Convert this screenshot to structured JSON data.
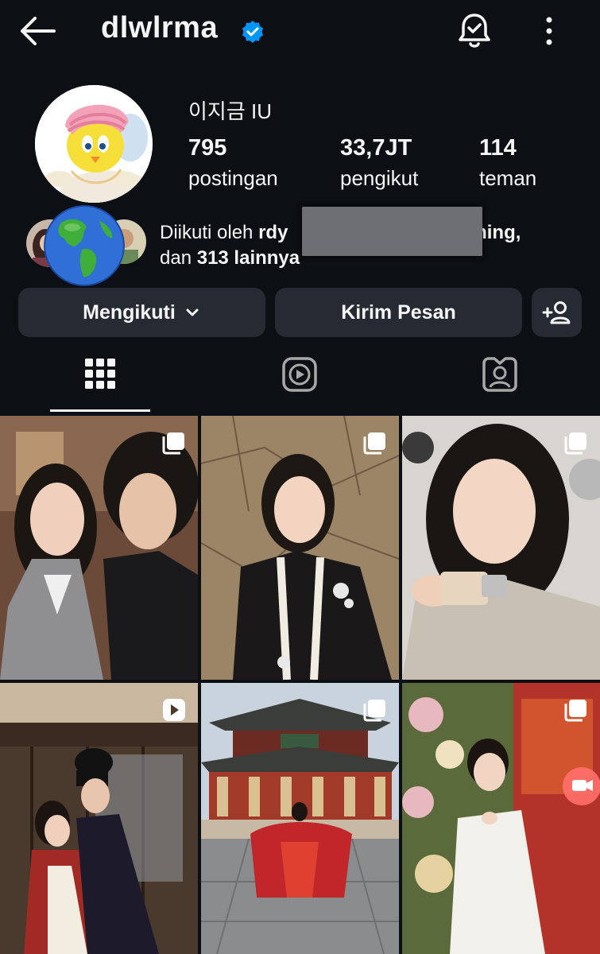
{
  "header": {
    "username": "dlwlrma"
  },
  "profile": {
    "display_name": "이지금 IU",
    "stats": [
      {
        "value": "795",
        "label": "postingan"
      },
      {
        "value": "33,7JT",
        "label": "pengikut"
      },
      {
        "value": "114",
        "label": "teman"
      }
    ],
    "followed_by": {
      "prefix": "Diikuti oleh ",
      "name_start": "rdy",
      "name_end": "ming,",
      "and": "dan ",
      "others": "313 lainnya"
    }
  },
  "buttons": {
    "following": "Mengikuti",
    "message": "Kirim Pesan"
  },
  "tabs": [
    "grid-tab",
    "reels-tab",
    "tagged-tab"
  ],
  "colors": {
    "background": "#0c1014",
    "button": "#262a33",
    "verified": "#0095f6",
    "text": "#f5f5f5"
  },
  "posts": [
    {
      "type": "carousel"
    },
    {
      "type": "carousel"
    },
    {
      "type": "carousel"
    },
    {
      "type": "reel"
    },
    {
      "type": "carousel"
    },
    {
      "type": "carousel"
    }
  ]
}
